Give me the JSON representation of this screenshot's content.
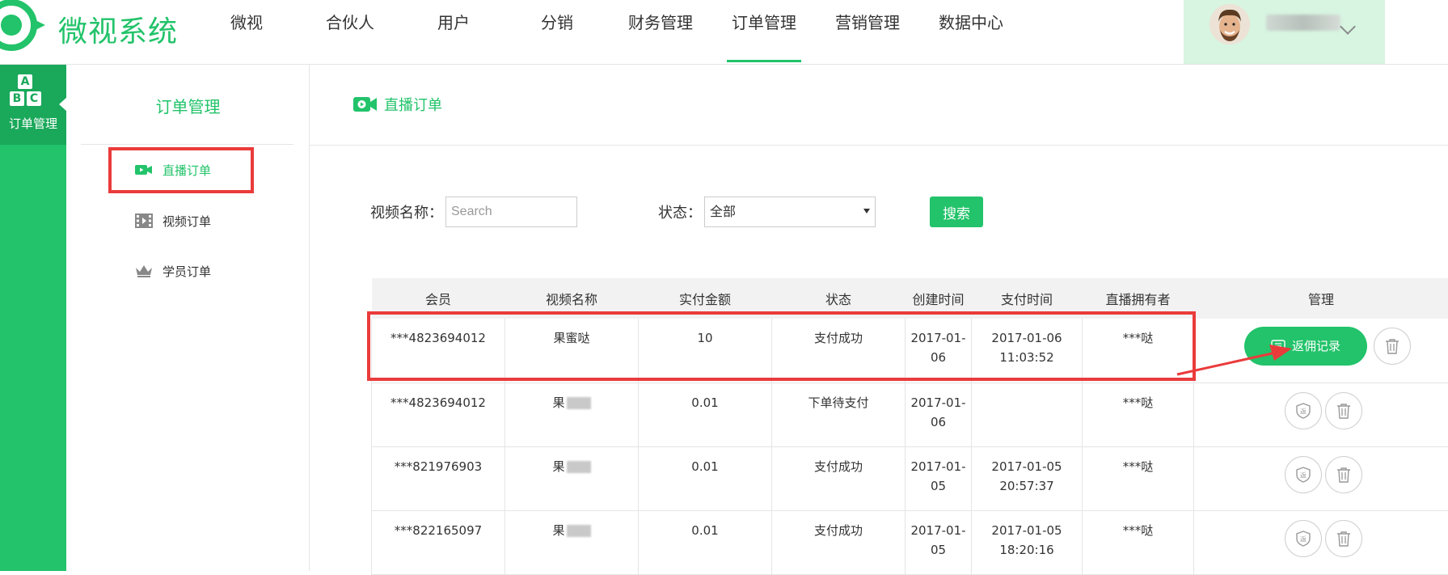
{
  "header": {
    "logo_text": "微视系统",
    "nav": [
      "微视",
      "合伙人",
      "用户",
      "分销",
      "财务管理",
      "订单管理",
      "营销管理",
      "数据中心"
    ],
    "active_nav": "订单管理"
  },
  "leftbar": {
    "label": "订单管理",
    "icon_letters": [
      "A",
      "B",
      "C"
    ]
  },
  "sidebar": {
    "title": "订单管理",
    "items": [
      {
        "label": "直播订单",
        "icon": "video-camera-icon"
      },
      {
        "label": "视频订单",
        "icon": "film-icon"
      },
      {
        "label": "学员订单",
        "icon": "crown-icon"
      }
    ]
  },
  "page": {
    "title": "直播订单"
  },
  "filters": {
    "video_name_label": "视频名称：",
    "search_placeholder": "Search",
    "status_label": "状态：",
    "status_value": "全部",
    "search_button": "搜索"
  },
  "table": {
    "headers": [
      "会员",
      "视频名称",
      "实付金额",
      "状态",
      "创建时间",
      "支付时间",
      "直播拥有者",
      "管理"
    ],
    "rows": [
      {
        "member": "***4823694012",
        "video": "果蜜哒",
        "amount": "10",
        "status": "支付成功",
        "created": "2017-01-06",
        "paid": "2017-01-06 11:03:52",
        "owner": "***哒"
      },
      {
        "member": "***4823694012",
        "video": "果",
        "amount": "0.01",
        "status": "下单待支付",
        "created": "2017-01-06",
        "paid": "",
        "owner": "***哒"
      },
      {
        "member": "***821976903",
        "video": "果",
        "amount": "0.01",
        "status": "支付成功",
        "created": "2017-01-05",
        "paid": "2017-01-05 20:57:37",
        "owner": "***哒"
      },
      {
        "member": "***822165097",
        "video": "果",
        "amount": "0.01",
        "status": "支付成功",
        "created": "2017-01-05",
        "paid": "2017-01-05 18:20:16",
        "owner": "***哒"
      }
    ],
    "rebate_button": "返佣记录",
    "rebate_icon_char": "返"
  },
  "colors": {
    "accent": "#22c36a",
    "highlight": "#ea3b3b"
  }
}
